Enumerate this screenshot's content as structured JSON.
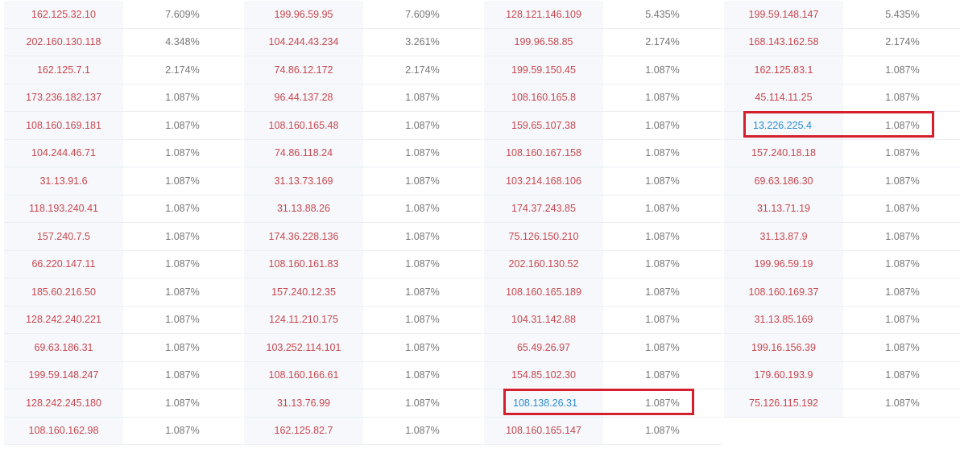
{
  "columns": [
    {
      "rows": [
        {
          "ip": "162.125.32.10",
          "pct": "7.609%"
        },
        {
          "ip": "202.160.130.118",
          "pct": "4.348%"
        },
        {
          "ip": "162.125.7.1",
          "pct": "2.174%"
        },
        {
          "ip": "173.236.182.137",
          "pct": "1.087%"
        },
        {
          "ip": "108.160.169.181",
          "pct": "1.087%"
        },
        {
          "ip": "104.244.46.71",
          "pct": "1.087%"
        },
        {
          "ip": "31.13.91.6",
          "pct": "1.087%"
        },
        {
          "ip": "118.193.240.41",
          "pct": "1.087%"
        },
        {
          "ip": "157.240.7.5",
          "pct": "1.087%"
        },
        {
          "ip": "66.220.147.11",
          "pct": "1.087%"
        },
        {
          "ip": "185.60.216.50",
          "pct": "1.087%"
        },
        {
          "ip": "128.242.240.221",
          "pct": "1.087%"
        },
        {
          "ip": "69.63.186.31",
          "pct": "1.087%"
        },
        {
          "ip": "199.59.148.247",
          "pct": "1.087%"
        },
        {
          "ip": "128.242.245.180",
          "pct": "1.087%"
        },
        {
          "ip": "108.160.162.98",
          "pct": "1.087%"
        }
      ]
    },
    {
      "rows": [
        {
          "ip": "199.96.59.95",
          "pct": "7.609%"
        },
        {
          "ip": "104.244.43.234",
          "pct": "3.261%"
        },
        {
          "ip": "74.86.12.172",
          "pct": "2.174%"
        },
        {
          "ip": "96.44.137.28",
          "pct": "1.087%"
        },
        {
          "ip": "108.160.165.48",
          "pct": "1.087%"
        },
        {
          "ip": "74.86.118.24",
          "pct": "1.087%"
        },
        {
          "ip": "31.13.73.169",
          "pct": "1.087%"
        },
        {
          "ip": "31.13.88.26",
          "pct": "1.087%"
        },
        {
          "ip": "174.36.228.136",
          "pct": "1.087%"
        },
        {
          "ip": "108.160.161.83",
          "pct": "1.087%"
        },
        {
          "ip": "157.240.12.35",
          "pct": "1.087%"
        },
        {
          "ip": "124.11.210.175",
          "pct": "1.087%"
        },
        {
          "ip": "103.252.114.101",
          "pct": "1.087%"
        },
        {
          "ip": "108.160.166.61",
          "pct": "1.087%"
        },
        {
          "ip": "31.13.76.99",
          "pct": "1.087%"
        },
        {
          "ip": "162.125.82.7",
          "pct": "1.087%"
        }
      ]
    },
    {
      "rows": [
        {
          "ip": "128.121.146.109",
          "pct": "5.435%"
        },
        {
          "ip": "199.96.58.85",
          "pct": "2.174%"
        },
        {
          "ip": "199.59.150.45",
          "pct": "1.087%"
        },
        {
          "ip": "108.160.165.8",
          "pct": "1.087%"
        },
        {
          "ip": "159.65.107.38",
          "pct": "1.087%"
        },
        {
          "ip": "108.160.167.158",
          "pct": "1.087%"
        },
        {
          "ip": "103.214.168.106",
          "pct": "1.087%"
        },
        {
          "ip": "174.37.243.85",
          "pct": "1.087%"
        },
        {
          "ip": "75.126.150.210",
          "pct": "1.087%"
        },
        {
          "ip": "202.160.130.52",
          "pct": "1.087%"
        },
        {
          "ip": "108.160.165.189",
          "pct": "1.087%"
        },
        {
          "ip": "104.31.142.88",
          "pct": "1.087%"
        },
        {
          "ip": "65.49.26.97",
          "pct": "1.087%"
        },
        {
          "ip": "154.85.102.30",
          "pct": "1.087%"
        },
        {
          "ip": "108.138.26.31",
          "pct": "1.087%",
          "highlight": true
        },
        {
          "ip": "108.160.165.147",
          "pct": "1.087%"
        }
      ]
    },
    {
      "rows": [
        {
          "ip": "199.59.148.147",
          "pct": "5.435%"
        },
        {
          "ip": "168.143.162.58",
          "pct": "2.174%"
        },
        {
          "ip": "162.125.83.1",
          "pct": "1.087%"
        },
        {
          "ip": "45.114.11.25",
          "pct": "1.087%"
        },
        {
          "ip": "13.226.225.4",
          "pct": "1.087%",
          "highlight": true
        },
        {
          "ip": "157.240.18.18",
          "pct": "1.087%"
        },
        {
          "ip": "69.63.186.30",
          "pct": "1.087%"
        },
        {
          "ip": "31.13.71.19",
          "pct": "1.087%"
        },
        {
          "ip": "31.13.87.9",
          "pct": "1.087%"
        },
        {
          "ip": "199.96.59.19",
          "pct": "1.087%"
        },
        {
          "ip": "108.160.169.37",
          "pct": "1.087%"
        },
        {
          "ip": "31.13.85.169",
          "pct": "1.087%"
        },
        {
          "ip": "199.16.156.39",
          "pct": "1.087%"
        },
        {
          "ip": "179.60.193.9",
          "pct": "1.087%"
        },
        {
          "ip": "75.126.115.192",
          "pct": "1.087%"
        }
      ]
    }
  ],
  "colors": {
    "ip_text": "#c8474f",
    "highlight_ip_text": "#2b8ccf",
    "pct_text": "#777777",
    "highlight_border": "#d4202d"
  }
}
